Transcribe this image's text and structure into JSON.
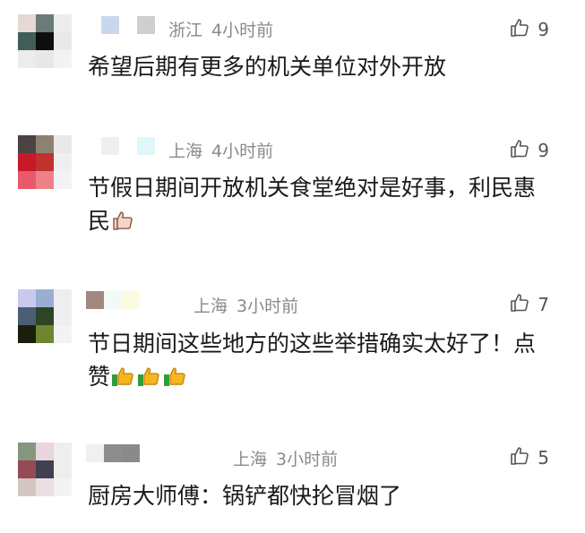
{
  "comments": [
    {
      "location": "浙江",
      "time": "4小时前",
      "likes": "9",
      "text": "希望后期有更多的机关单位对外开放",
      "emoji": "",
      "avatar_colors": [
        "#e6d8d4",
        "#6a7b78",
        "#ececec",
        "#3f5e58",
        "#0e0e0e",
        "#e9e9e9",
        "#ececec",
        "#e8e8e8",
        "#f3f3f3"
      ],
      "nick_colors": [
        "#c9d7ee",
        "#ffffff",
        "#cfcfcf"
      ]
    },
    {
      "location": "上海",
      "time": "4小时前",
      "likes": "9",
      "text": "节假日期间开放机关食堂绝对是好事，利民惠民",
      "emoji": "thumbs-up-light",
      "avatar_colors": [
        "#4a4342",
        "#8d8272",
        "#e9e9e9",
        "#c9182a",
        "#c0322c",
        "#efefef",
        "#e85a6a",
        "#ee8088",
        "#f3f3f3"
      ],
      "nick_colors": [
        "#efefef",
        "#ffffff",
        "#dff7f8"
      ]
    },
    {
      "location": "上海",
      "time": "3小时前",
      "likes": "7",
      "text": "节日期间这些地方的这些举措确实太好了！点赞",
      "emoji": "thumbs-up-yellow-x3",
      "avatar_colors": [
        "#c9c9ef",
        "#9aaed4",
        "#eeeeee",
        "#4b5e73",
        "#2f4427",
        "#eeeeee",
        "#1b1e0d",
        "#6c8730",
        "#f3f3f3"
      ],
      "nick_colors": [
        "#a38880",
        "#f0fbf7",
        "#fbfbe2"
      ]
    },
    {
      "location": "上海",
      "time": "3小时前",
      "likes": "5",
      "text": "厨房大师傅：锅铲都快抡冒烟了",
      "emoji": "",
      "avatar_colors": [
        "#87977f",
        "#e8d6dc",
        "#eeeeee",
        "#964a55",
        "#423f52",
        "#eeeeee",
        "#d3c6c2",
        "#eadfe2",
        "#f3f3f3"
      ],
      "nick_colors": [
        "#f0f0f0",
        "#8d8d8d",
        "#8a8a8a"
      ]
    }
  ]
}
